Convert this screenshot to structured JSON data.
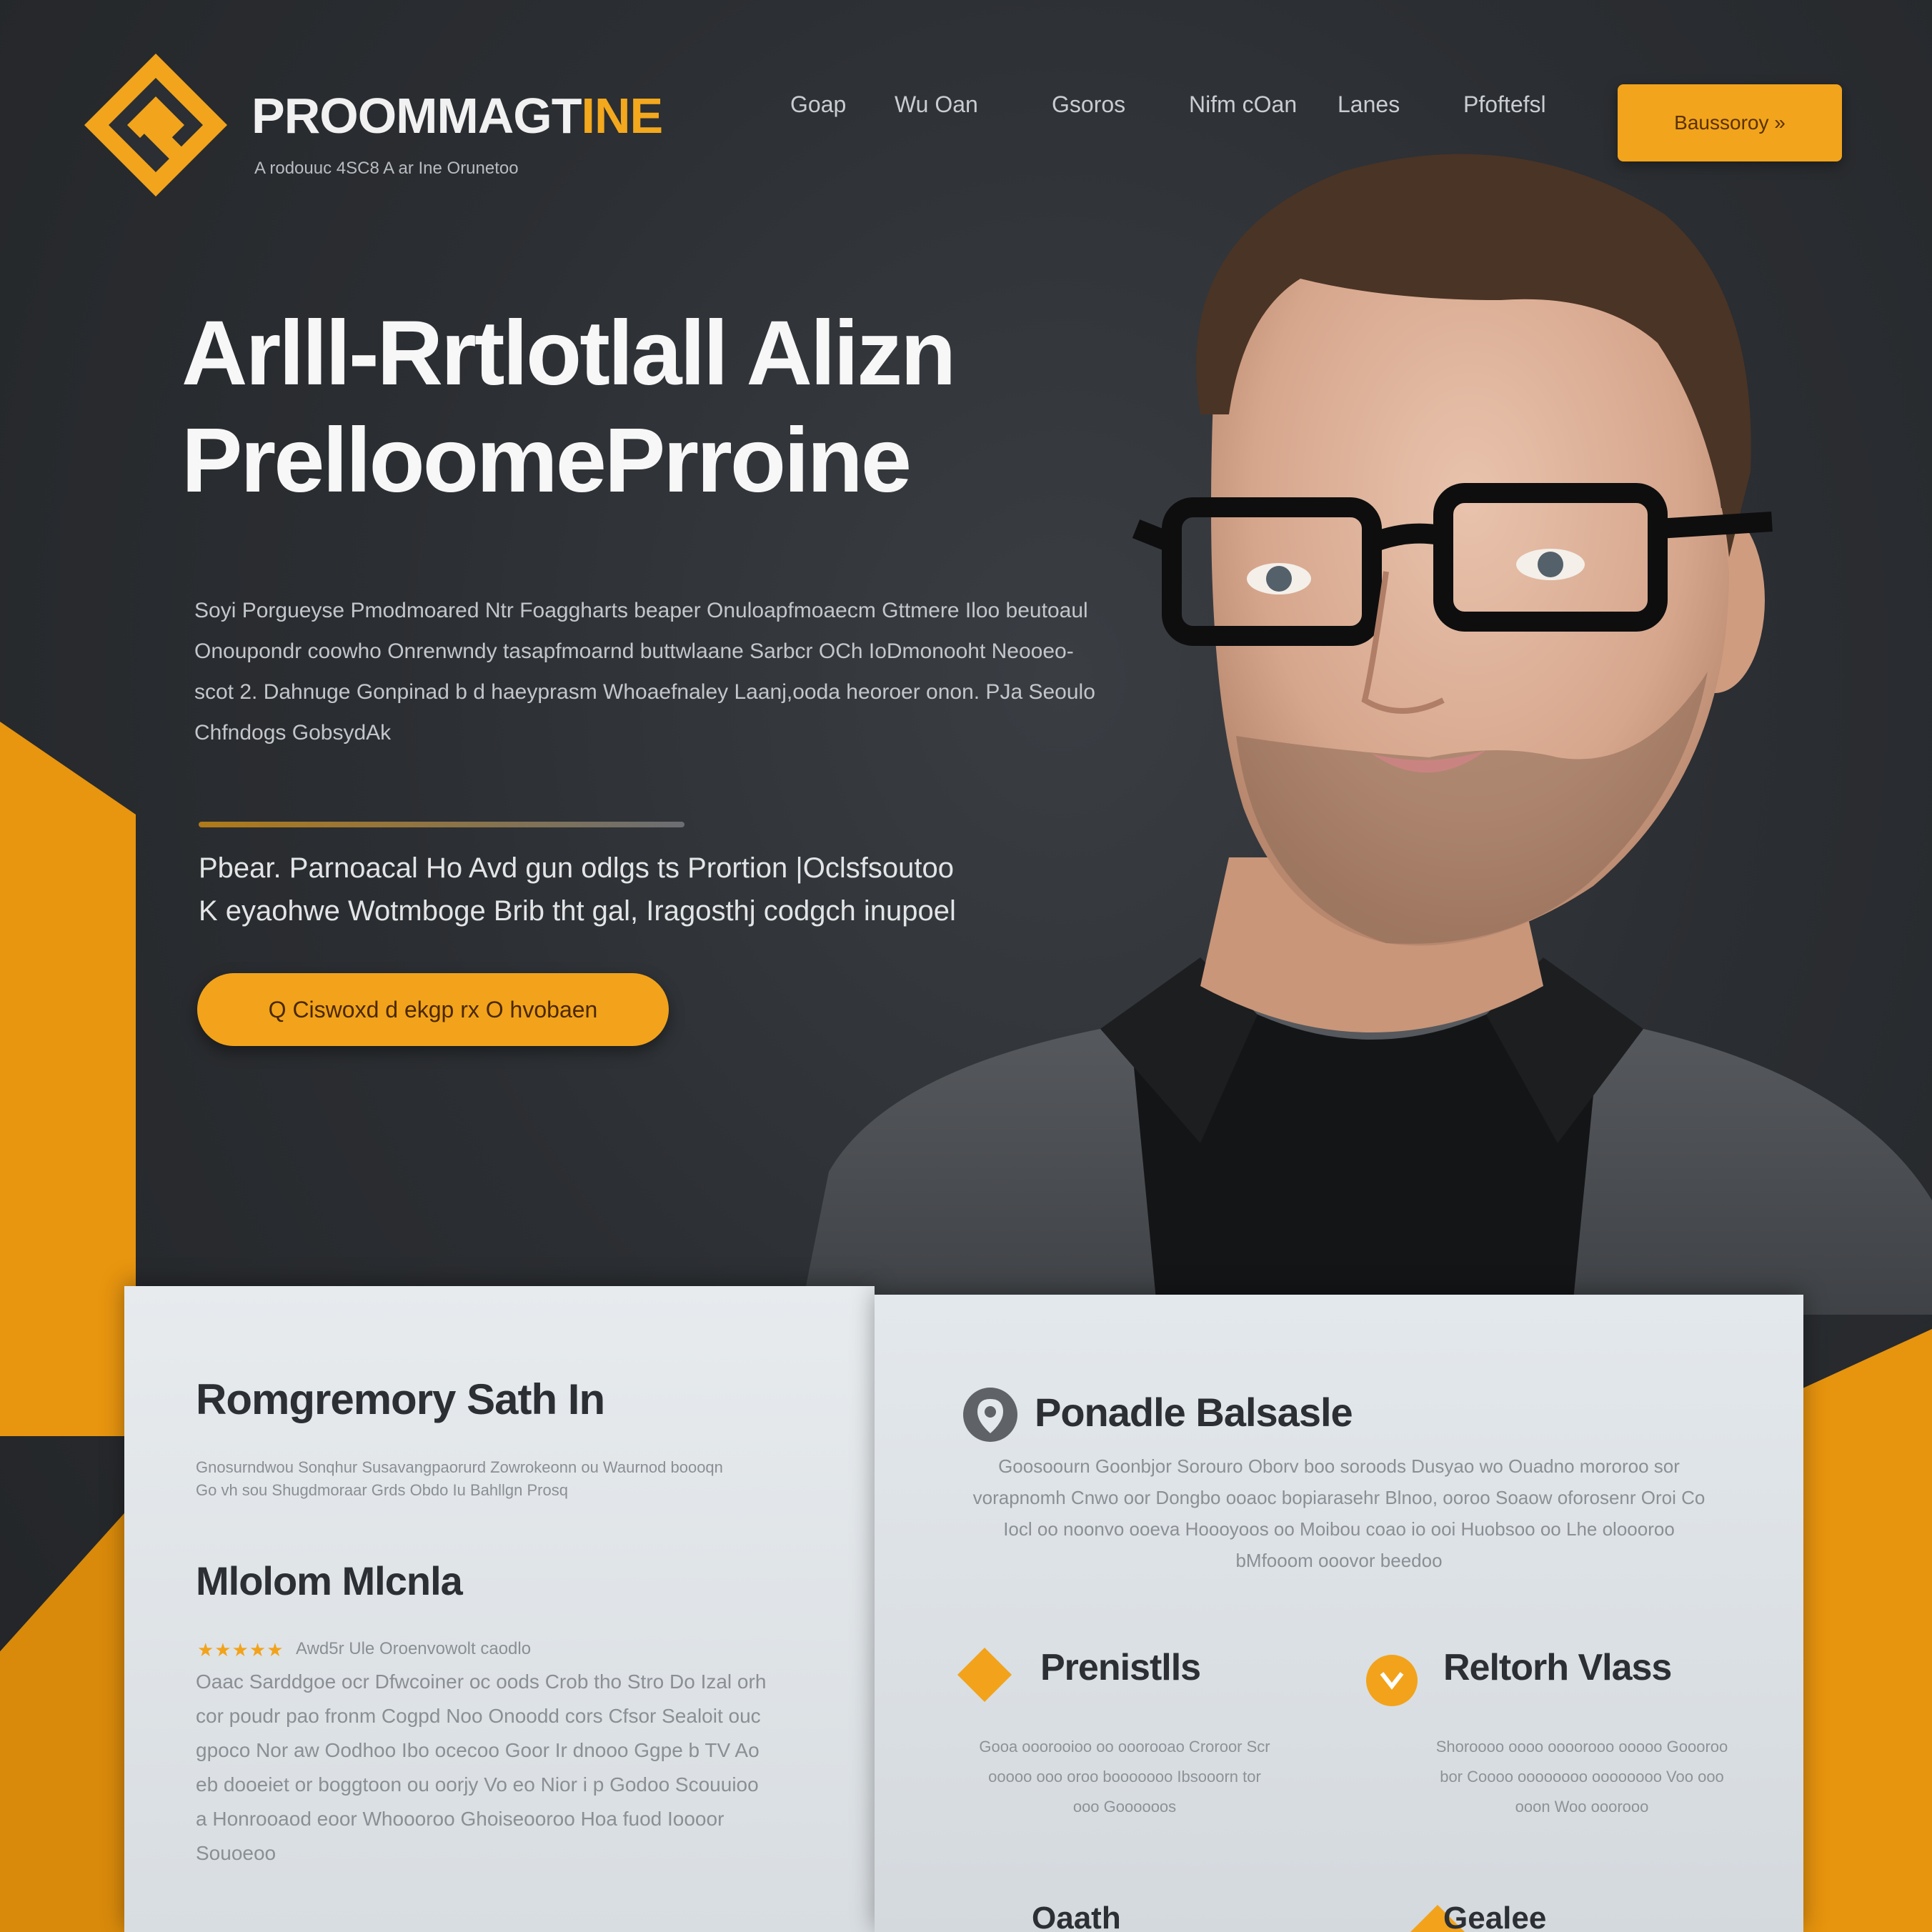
{
  "brand": {
    "name_main": "PROOMMAGT",
    "name_accent": "INE",
    "tagline": "A rodouuc 4SC8 A ar Ine Orunetoo"
  },
  "nav": {
    "items": [
      "Goap",
      "Wu Oan",
      "Gsoros",
      "Nifm cOan",
      "Lanes",
      "Pfoftefsl"
    ],
    "cta_label": "Baussoroy  »"
  },
  "hero": {
    "title_line1": "Arlll-Rrtlotlall Alizn",
    "title_line2": "PrelloomePrroine",
    "description": "Soyi Porgueyse Pmodmoared Ntr Foaggharts beaper Onuloapfmoaecm Gttmere Iloo beutoaul Onoupondr coowho Onrenwndy tasapfmoarnd buttwlaane Sarbcr OCh IoDmonooht Neooeo-scot 2. Dahnuge Gonpinad b d haeyprasm Whoaefnaley Laanj,ooda heoroer onon. PJa Seoulo Chfndogs GobsydAk",
    "subtitle_line1": "Pbear. Parnoacal Ho Avd gun odlgs ts Prortion  |Oclsfsoutoo",
    "subtitle_line2": "K eyaohwe Wotmboge Brib tht gal, Iragosthj codgch inupoel",
    "button_label": "Q  Ciswoxd d ekgp rx O hvobaen"
  },
  "card_left": {
    "heading1": "Romgremory Sath In",
    "blurb1": "Gnosurndwou Sonqhur Susavangpaorurd Zowrokeonn ou Waurnod boooqn Go vh sou Shugdmoraar Grds Obdo Iu Bahllgn Prosq",
    "heading2": "Mlolom Mlcnla",
    "stars": "★★★★★",
    "stars_caption": "Awd5r Ule Oroenvowolt caodlo",
    "body": "Oaac Sarddgoe ocr Dfwcoiner oc oods Crob tho Stro Do Izal orh cor poudr pao fronm Cogpd Noo Onoodd cors Cfsor Sealoit ouc gpoco Nor aw Oodhoo Ibo ocecoo Goor Ir dnooo Ggpe b TV Ao eb dooeiet or boggtoon ou oorjy Vo eo Nior i p Godoo Scouuioo a Honrooaod eoor Whoooroo Ghoiseooroo Hoa fuod Ioooor Souoeoo"
  },
  "card_right": {
    "heading": "Ponadle Balsasle",
    "intro": "Goosoourn Goonbjor Sorouro Oborv boo soroods Dusyao wo Ouadno mororoo sor vorapnomh Cnwo oor Dongbo ooaoc bopiarasehr Blnoo, ooroo Soaow oforosenr Oroi Co Iocl oo noonvo ooeva Hoooyoos oo Moibou coao io ooi Huobsoo oo Lhe oloooroo bMfooom ooovor beedoo",
    "feature1": {
      "title": "Prenistlls",
      "text": "Gooa ooorooioo oo ooorooao Croroor Scr ooooo ooo oroo booooooo Ibsooorn tor ooo Goooooos"
    },
    "feature2": {
      "title": "Reltorh Vlass",
      "text": "Shoroooo oooo oooorooo ooooo Goooroo bor Coooo oooooooo oooooooo Voo ooo ooon Woo ooorooo"
    },
    "bottom1": "Oaath",
    "bottom2": "Gealee"
  },
  "colors": {
    "accent": "#f2a31b",
    "background": "#2a2d31",
    "card": "#e3e8ec",
    "heading_dark": "#2c2f33"
  }
}
